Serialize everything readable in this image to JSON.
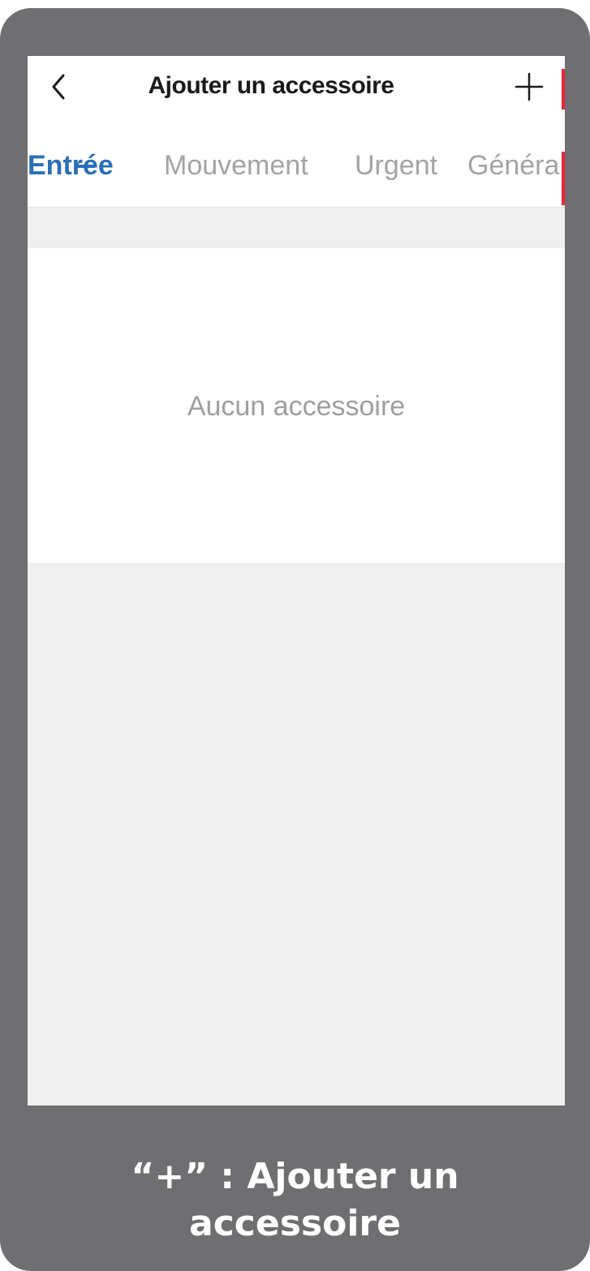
{
  "header": {
    "title": "Ajouter un accessoire",
    "back_icon": "chevron-left-icon",
    "add_icon": "plus-icon"
  },
  "tabs": [
    {
      "label": "Entrée",
      "active": true
    },
    {
      "label": "Mouvement",
      "active": false
    },
    {
      "label": "Urgent",
      "active": false
    },
    {
      "label": "Généra",
      "active": false
    }
  ],
  "empty_state": {
    "message": "Aucun accessoire"
  },
  "caption": {
    "line1": "“+” : Ajouter un",
    "line2": "accessoire"
  },
  "colors": {
    "frame": "#6f6f71",
    "accent": "#2a6fb6",
    "marker": "#e6263a",
    "background": "#efefef"
  }
}
